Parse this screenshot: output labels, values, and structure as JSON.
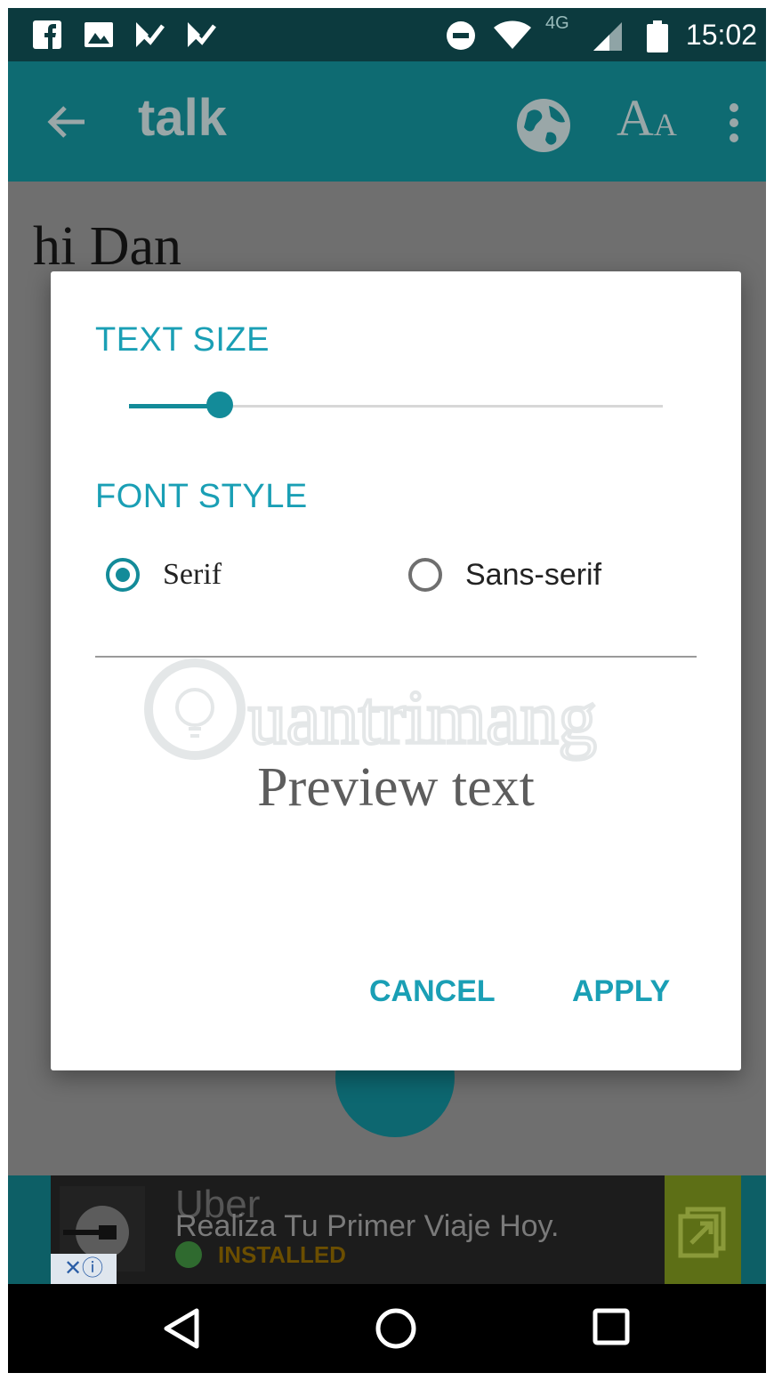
{
  "status_bar": {
    "time": "15:02",
    "network": "4G",
    "icons": [
      "facebook-icon",
      "image-icon",
      "tasks-icon",
      "tasks-icon",
      "do-not-disturb-icon",
      "wifi-icon",
      "signal-icon",
      "battery-icon"
    ]
  },
  "app_bar": {
    "title": "talk",
    "aa_big": "A",
    "aa_small": "A",
    "icons": [
      "back-arrow-icon",
      "globe-icon",
      "text-size-icon",
      "more-vert-icon"
    ]
  },
  "content": {
    "message": "hi Dan"
  },
  "dialog": {
    "text_size": {
      "title": "TEXT SIZE",
      "slider_fraction": 0.17
    },
    "font_style": {
      "title": "FONT STYLE",
      "options": [
        {
          "label": "Serif",
          "selected": true
        },
        {
          "label": "Sans-serif",
          "selected": false
        }
      ]
    },
    "preview_text": "Preview text",
    "cancel_label": "CANCEL",
    "apply_label": "APPLY",
    "watermark_text": "uantrimang"
  },
  "ad": {
    "line1": "Uber",
    "line2": "Realiza Tu Primer Viaje Hoy.",
    "status": "INSTALLED",
    "close_label": "✕ⓘ"
  },
  "colors": {
    "accent": "#1a9fb5",
    "app_bar": "#0e6b72",
    "status_bar": "#0c3a3e",
    "scrim": "#6f6f6f"
  }
}
